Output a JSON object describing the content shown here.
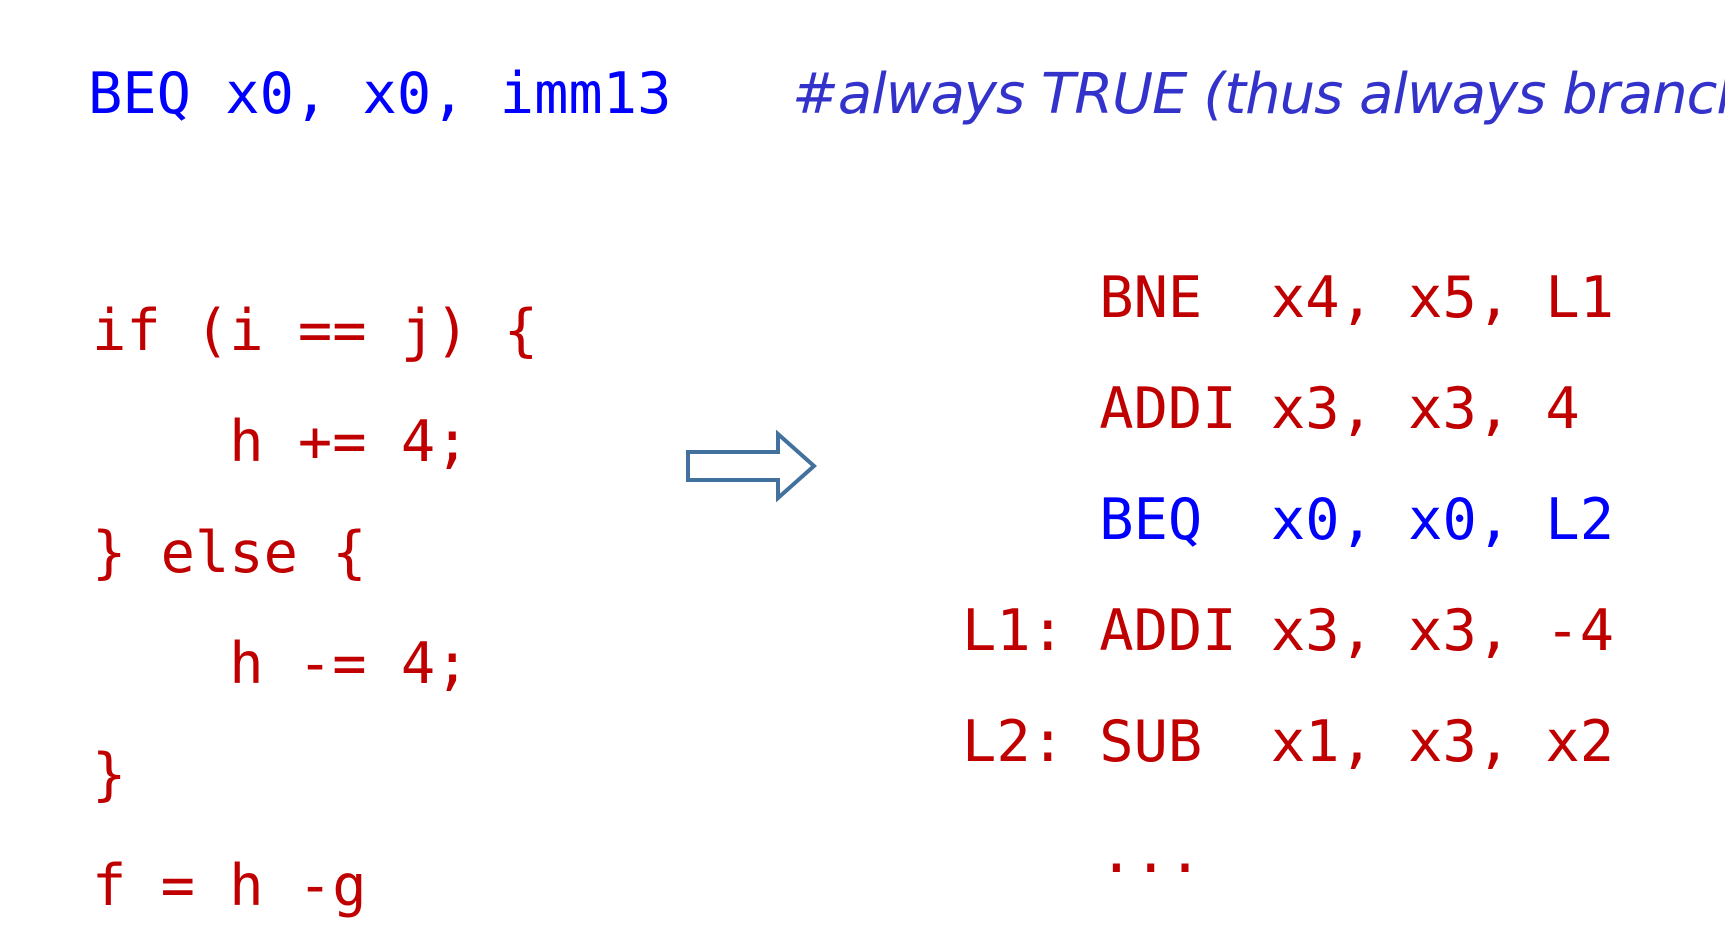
{
  "header": {
    "instruction": "BEQ x0, x0, imm13",
    "comment": "#always TRUE (thus always branch)"
  },
  "c_code": {
    "lines": [
      "if (i == j) {",
      "    h += 4;",
      "} else {",
      "    h -= 4;",
      "}",
      "f = h -g"
    ]
  },
  "arrow": {
    "icon": "right-block-arrow-icon",
    "stroke_color": "#41719c"
  },
  "assembly": {
    "lines": [
      {
        "label": "   ",
        "mnemonic": "BNE ",
        "operands": "x4, x5, L1",
        "color": "red"
      },
      {
        "label": "   ",
        "mnemonic": "ADDI",
        "operands": "x3, x3, 4",
        "color": "red"
      },
      {
        "label": "   ",
        "mnemonic": "BEQ ",
        "operands": "x0, x0, L2",
        "color": "blue"
      },
      {
        "label": "L1:",
        "mnemonic": "ADDI",
        "operands": "x3, x3, -4",
        "color": "red"
      },
      {
        "label": "L2:",
        "mnemonic": "SUB ",
        "operands": "x1, x3, x2",
        "color": "red"
      },
      {
        "label": "   ",
        "mnemonic": "...",
        "operands": "",
        "color": "red"
      }
    ]
  },
  "colors": {
    "code_red": "#c00000",
    "code_blue": "#0000ff",
    "comment_blue": "#3333cc"
  }
}
